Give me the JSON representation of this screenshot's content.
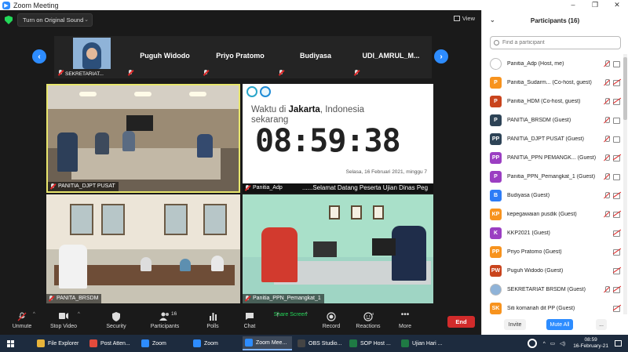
{
  "window": {
    "title": "Zoom Meeting",
    "controls": [
      "–",
      "❐",
      "✕"
    ]
  },
  "topbar": {
    "sound_button": "Turn on Original Sound",
    "view_label": "View"
  },
  "filmstrip": {
    "tiles": [
      {
        "label": "SEKRETARIAT...",
        "name": ""
      },
      {
        "label": "",
        "name": "Puguh Widodo"
      },
      {
        "label": "",
        "name": "Priyo Pratomo"
      },
      {
        "label": "",
        "name": "Budiyasa"
      },
      {
        "label": "",
        "name": "UDI_AMRUL_M..."
      }
    ]
  },
  "videos": [
    {
      "label": "PANITIA_DJPT PUSAT"
    },
    {
      "label": "Panitia_Adp"
    },
    {
      "label": "PANITA_BRSDM"
    },
    {
      "label": "Panitia_PPN_Pemangkat_1"
    }
  ],
  "clock_panel": {
    "prefix": "Waktu di ",
    "city": "Jakarta",
    "suffix": ", Indonesia",
    "line2": "sekarang",
    "time": "08:59:38",
    "date": "Selasa, 16 Februari 2021, minggu 7",
    "marquee": "......Selamat Datang Peserta Ujian Dinas Peg"
  },
  "toolbar": {
    "unmute": "Unmute",
    "stop_video": "Stop Video",
    "security": "Security",
    "participants": "Participants",
    "participants_count": "16",
    "polls": "Polls",
    "chat": "Chat",
    "share_screen": "Share Screen",
    "record": "Record",
    "reactions": "Reactions",
    "more": "More",
    "end": "End"
  },
  "panel": {
    "title": "Participants (16)",
    "search_placeholder": "Find a participant",
    "participants": [
      {
        "initials": "",
        "name": "Panitia_Adp (Host, me)",
        "color": "#ffffff",
        "mic": "muted",
        "cam": "on"
      },
      {
        "initials": "P",
        "name": "Panitia_Sudarm... (Co-host, guest)",
        "color": "#f7931e",
        "mic": "muted",
        "cam": "off"
      },
      {
        "initials": "P",
        "name": "Panitia_HDM (Co-host, guest)",
        "color": "#c9441d",
        "mic": "muted",
        "cam": "off"
      },
      {
        "initials": "P",
        "name": "PANITIA_BRSDM (Guest)",
        "color": "#2d4356",
        "mic": "muted",
        "cam": "on"
      },
      {
        "initials": "PP",
        "name": "PANITIA_DJPT PUSAT (Guest)",
        "color": "#2d4356",
        "mic": "muted",
        "cam": "on"
      },
      {
        "initials": "PP",
        "name": "PANITIA_PPN PEMANGK... (Guest)",
        "color": "#9b3ec2",
        "mic": "muted",
        "cam": "off"
      },
      {
        "initials": "P",
        "name": "Panitia_PPN_Pemangkat_1 (Guest)",
        "color": "#9b3ec2",
        "mic": "muted",
        "cam": "on"
      },
      {
        "initials": "B",
        "name": "Budiyasa (Guest)",
        "color": "#2d7cf6",
        "mic": "muted",
        "cam": "off"
      },
      {
        "initials": "KP",
        "name": "kepegawaian pusdik (Guest)",
        "color": "#f7931e",
        "mic": "muted",
        "cam": "off"
      },
      {
        "initials": "K",
        "name": "KKP2021 (Guest)",
        "color": "#9b3ec2",
        "mic": "",
        "cam": "off"
      },
      {
        "initials": "PP",
        "name": "Priyo Pratomo (Guest)",
        "color": "#f7931e",
        "mic": "",
        "cam": "off"
      },
      {
        "initials": "PW",
        "name": "Puguh Widodo (Guest)",
        "color": "#c9441d",
        "mic": "",
        "cam": "off"
      },
      {
        "initials": "",
        "name": "SEKRETARIAT BRSDM (Guest)",
        "color": "#8fb3d8",
        "mic": "muted",
        "cam": "off"
      },
      {
        "initials": "SK",
        "name": "Siti komariah dit PP (Guest)",
        "color": "#f7931e",
        "mic": "",
        "cam": "off"
      }
    ],
    "invite": "Invite",
    "mute_all": "Mute All",
    "more": "..."
  },
  "taskbar": {
    "items": [
      {
        "label": "File Explorer",
        "color": "#e8b43a"
      },
      {
        "label": "Post Atten...",
        "color": "#e34b3c"
      },
      {
        "label": "Zoom",
        "color": "#2D8CFF"
      },
      {
        "label": "Zoom",
        "color": "#2D8CFF"
      },
      {
        "label": "Zoom Mee...",
        "color": "#2D8CFF"
      },
      {
        "label": "OBS Studio...",
        "color": "#444444"
      },
      {
        "label": "SOP Host ...",
        "color": "#1f7a44"
      },
      {
        "label": "Ujian Hari ...",
        "color": "#1f7a44"
      }
    ],
    "time": "08:59",
    "date": "16-February-21"
  },
  "colors": {
    "accent": "#2D8CFF",
    "end": "#d22b2b",
    "share": "#23d959",
    "active_speaker": "#e8e66d"
  }
}
